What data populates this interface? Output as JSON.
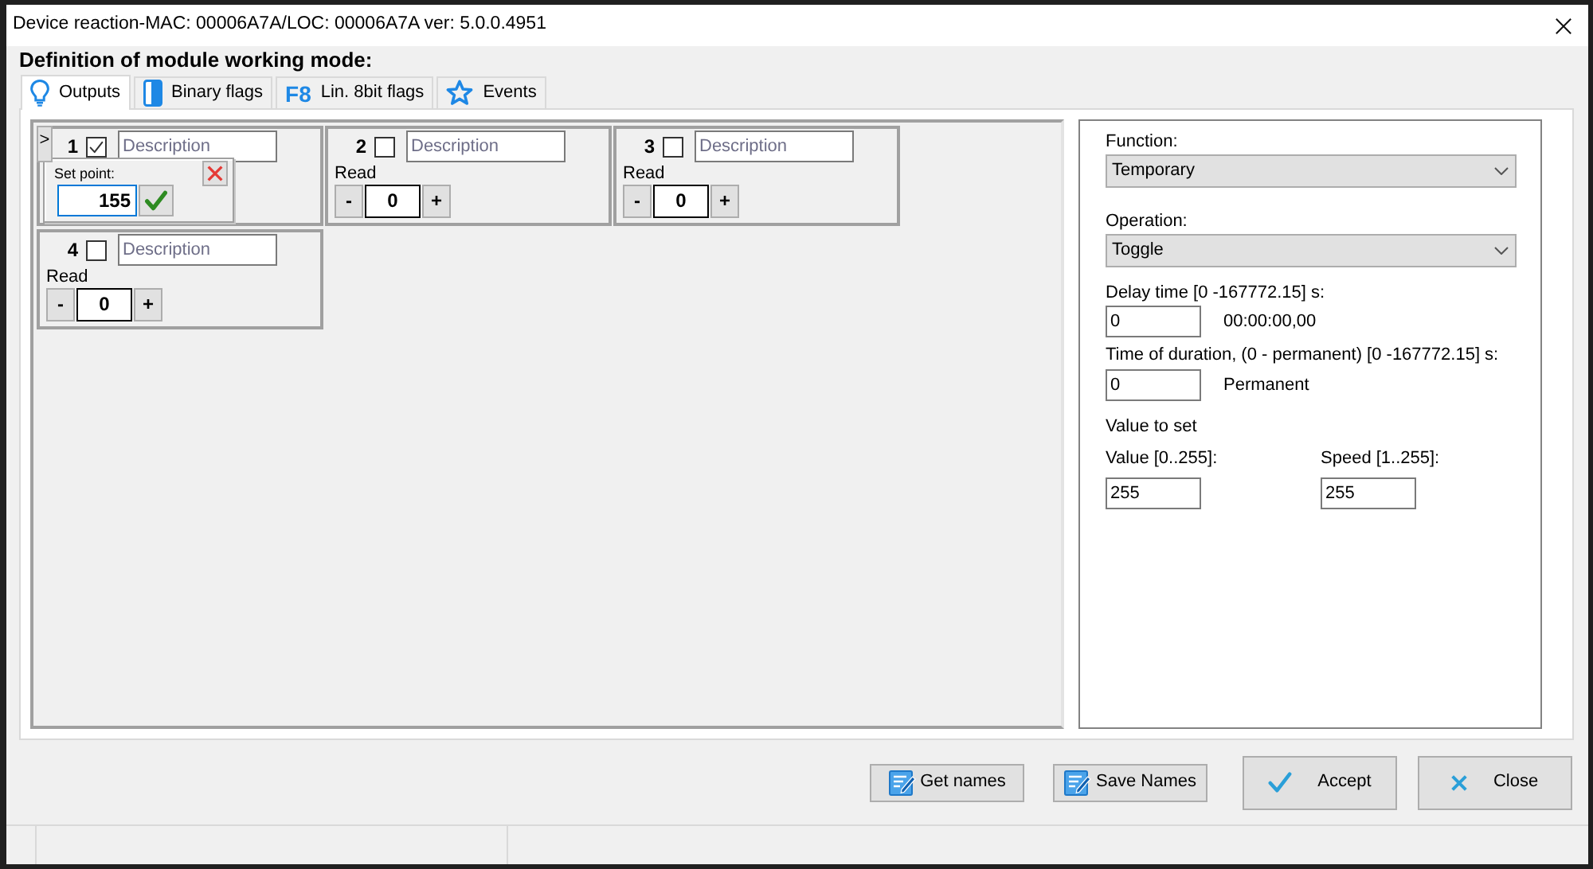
{
  "window": {
    "title": "Device reaction-MAC: 00006A7A/LOC: 00006A7A ver: 5.0.0.4951"
  },
  "heading": "Definition of module working mode:",
  "tabs": [
    {
      "label": "Outputs",
      "selected": true
    },
    {
      "label": "Binary flags",
      "selected": false
    },
    {
      "label": "Lin. 8bit flags",
      "icon_text": "F8",
      "selected": false
    },
    {
      "label": "Events",
      "selected": false
    }
  ],
  "outputs": [
    {
      "number": "1",
      "checked": true,
      "placeholder": "Description"
    },
    {
      "number": "2",
      "checked": false,
      "placeholder": "Description",
      "read_label": "Read",
      "decrement": "-",
      "value": "0",
      "increment": "+"
    },
    {
      "number": "3",
      "checked": false,
      "placeholder": "Description",
      "read_label": "Read",
      "decrement": "-",
      "value": "0",
      "increment": "+"
    },
    {
      "number": "4",
      "checked": false,
      "placeholder": "Description",
      "read_label": "Read",
      "decrement": "-",
      "value": "0",
      "increment": "+"
    }
  ],
  "set_point_popup": {
    "toggle": ">",
    "label": "Set point:",
    "value": "155"
  },
  "settings": {
    "function": {
      "label": "Function:",
      "value": "Temporary"
    },
    "operation": {
      "label": "Operation:",
      "value": "Toggle"
    },
    "delay": {
      "label": "Delay time [0 -167772.15] s:",
      "value": "0",
      "readout": "00:00:00,00"
    },
    "duration": {
      "label": "Time of duration, (0 - permanent) [0 -167772.15] s:",
      "value": "0",
      "readout": "Permanent"
    },
    "value_to_set": {
      "heading": "Value to set",
      "value": {
        "label": "Value [0..255]:",
        "value": "255"
      },
      "speed": {
        "label": "Speed [1..255]:",
        "value": "255"
      }
    }
  },
  "buttons": [
    {
      "label": "Get names",
      "kind": "names"
    },
    {
      "label": "Save Names",
      "kind": "names"
    },
    {
      "label": "Accept",
      "kind": "dialog"
    },
    {
      "label": "Close",
      "kind": "dialog"
    }
  ]
}
